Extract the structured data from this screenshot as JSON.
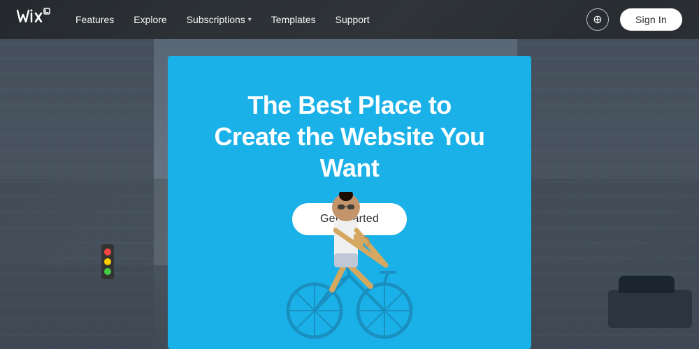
{
  "nav": {
    "logo": "Wix",
    "links": [
      {
        "label": "Features",
        "hasDropdown": false
      },
      {
        "label": "Explore",
        "hasDropdown": false
      },
      {
        "label": "Subscriptions",
        "hasDropdown": true
      },
      {
        "label": "Templates",
        "hasDropdown": false
      },
      {
        "label": "Support",
        "hasDropdown": false
      }
    ],
    "signin_label": "Sign In",
    "globe_icon": "🌐"
  },
  "hero": {
    "title_line1": "The Best Place to",
    "title_line2": "Create the Website You Want",
    "cta_label": "Get Started",
    "bg_color": "#1ab0e8"
  },
  "colors": {
    "navbar_bg": "rgba(20,20,20,0.6)",
    "hero_blue": "#1ab0e8",
    "white": "#ffffff",
    "dark_text": "#2c2c2c"
  }
}
